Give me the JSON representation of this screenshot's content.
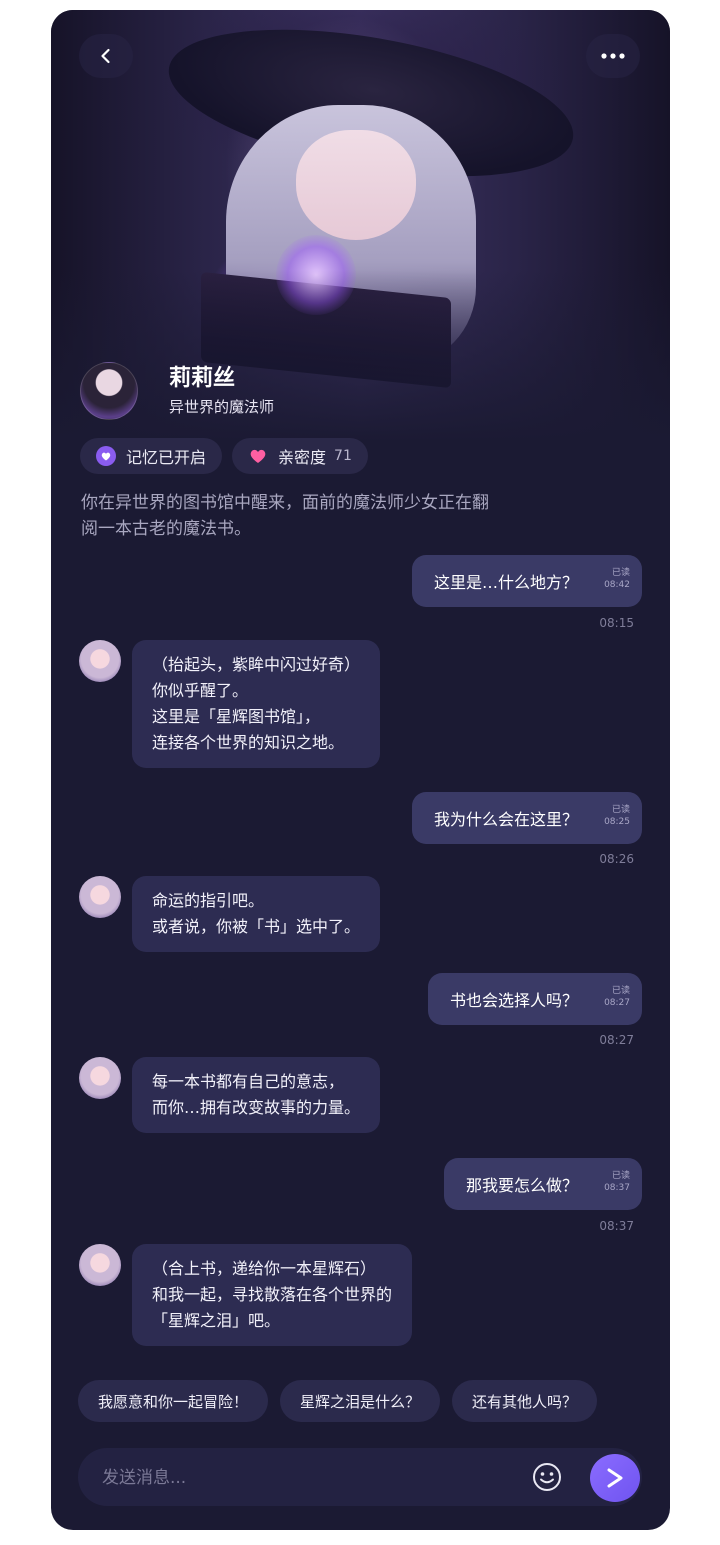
{
  "header": {
    "back_icon": "chevron-left-icon",
    "more_icon": "ellipsis-icon"
  },
  "character": {
    "name": "莉莉丝",
    "title": "异世界的魔法师"
  },
  "chips": {
    "memory_label": "记忆已开启",
    "intimacy_label": "亲密度",
    "intimacy_value": "71"
  },
  "narration": "你在异世界的图书馆中醒来，面前的魔法师少女正在翻阅一本古老的魔法书。",
  "messages": [
    {
      "role": "user",
      "text": "这里是…什么地方？",
      "status": "已读",
      "time_small": "08:42",
      "time": "08:15"
    },
    {
      "role": "char",
      "lines": [
        "（抬起头，紫眸中闪过好奇）",
        "你似乎醒了。",
        "这里是「星辉图书馆」，",
        "连接各个世界的知识之地。"
      ]
    },
    {
      "role": "user",
      "text": "我为什么会在这里？",
      "status": "已读",
      "time_small": "08:25",
      "time": "08:26"
    },
    {
      "role": "char",
      "lines": [
        "命运的指引吧。",
        "或者说，你被「书」选中了。"
      ]
    },
    {
      "role": "user",
      "text": "书也会选择人吗？",
      "status": "已读",
      "time_small": "08:27",
      "time": "08:27"
    },
    {
      "role": "char",
      "lines": [
        "每一本书都有自己的意志，",
        "而你…拥有改变故事的力量。"
      ]
    },
    {
      "role": "user",
      "text": "那我要怎么做？",
      "status": "已读",
      "time_small": "08:37",
      "time": "08:37"
    },
    {
      "role": "char",
      "lines": [
        "（合上书，递给你一本星辉石）",
        "和我一起，寻找散落在各个世界的",
        "「星辉之泪」吧。"
      ]
    }
  ],
  "suggestions": [
    "我愿意和你一起冒险！",
    "星辉之泪是什么？",
    "还有其他人吗？"
  ],
  "composer": {
    "placeholder": "发送消息...",
    "emoji_icon": "smile-icon",
    "send_icon": "send-arrow-icon"
  },
  "colors": {
    "background": "#1b1a33",
    "user_bubble": "#3a3a66",
    "char_bubble": "#2d2c52",
    "accent": "#7b5cff",
    "heart": "#ff5fa2"
  }
}
